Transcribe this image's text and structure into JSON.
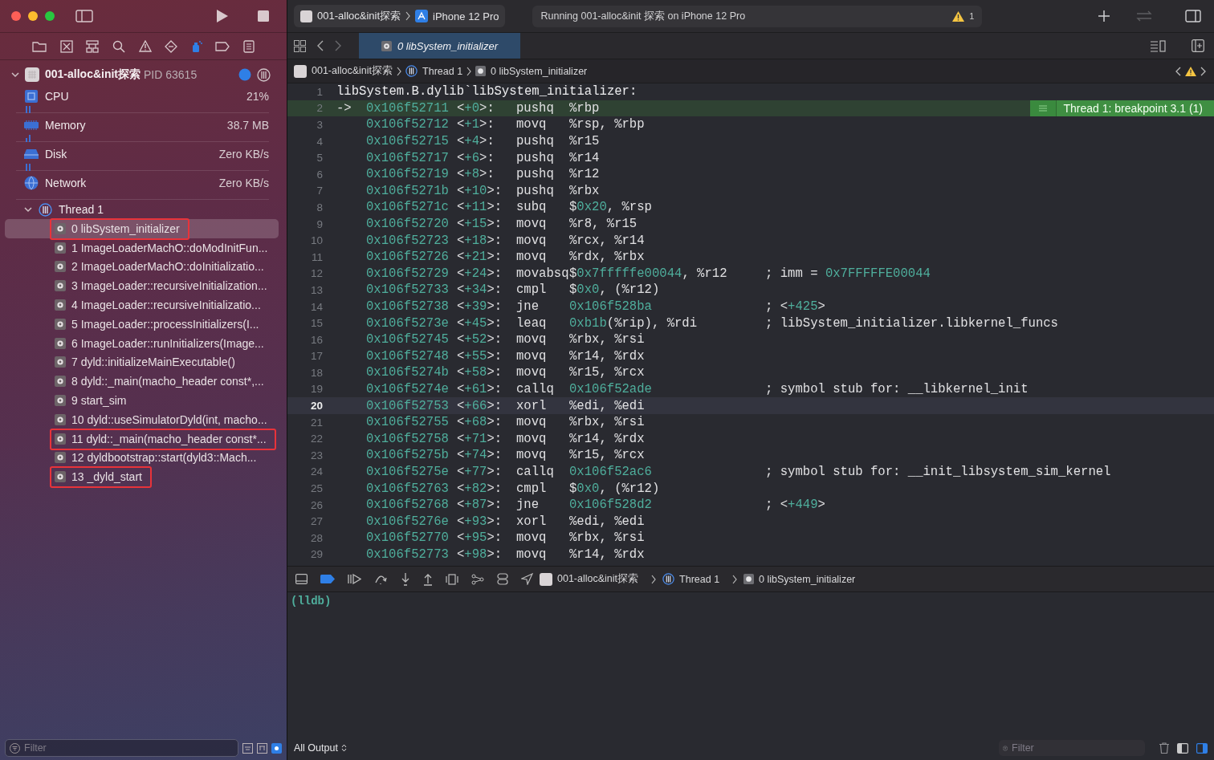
{
  "toolbar": {
    "scheme": "001-alloc&init探索",
    "device": "iPhone 12 Pro",
    "status": "Running 001-alloc&init 探索 on iPhone 12 Pro",
    "warning_count": "1"
  },
  "sidebar": {
    "process": {
      "name": "001-alloc&init探索",
      "pid": "PID 63615"
    },
    "gauges": [
      {
        "kind": "cpu",
        "name": "CPU",
        "value": "21%"
      },
      {
        "kind": "memory",
        "name": "Memory",
        "value": "38.7 MB"
      },
      {
        "kind": "disk",
        "name": "Disk",
        "value": "Zero KB/s"
      },
      {
        "kind": "network",
        "name": "Network",
        "value": "Zero KB/s"
      }
    ],
    "thread": {
      "name": "Thread 1",
      "expanded": true
    },
    "frames": [
      {
        "label": "0 libSystem_initializer",
        "selected": true,
        "annotated": true
      },
      {
        "label": "1 ImageLoaderMachO::doModInitFun...",
        "selected": false,
        "annotated": false
      },
      {
        "label": "2 ImageLoaderMachO::doInitializatio...",
        "selected": false,
        "annotated": false
      },
      {
        "label": "3 ImageLoader::recursiveInitialization...",
        "selected": false,
        "annotated": false
      },
      {
        "label": "4 ImageLoader::recursiveInitializatio...",
        "selected": false,
        "annotated": false
      },
      {
        "label": "5 ImageLoader::processInitializers(I...",
        "selected": false,
        "annotated": false
      },
      {
        "label": "6 ImageLoader::runInitializers(Image...",
        "selected": false,
        "annotated": false
      },
      {
        "label": "7 dyld::initializeMainExecutable()",
        "selected": false,
        "annotated": false
      },
      {
        "label": "8 dyld::_main(macho_header const*,...",
        "selected": false,
        "annotated": false
      },
      {
        "label": "9 start_sim",
        "selected": false,
        "annotated": false
      },
      {
        "label": "10 dyld::useSimulatorDyld(int, macho...",
        "selected": false,
        "annotated": false
      },
      {
        "label": "11 dyld::_main(macho_header const*...",
        "selected": false,
        "annotated": true
      },
      {
        "label": "12 dyldbootstrap::start(dyld3::Mach...",
        "selected": false,
        "annotated": false
      },
      {
        "label": "13 _dyld_start",
        "selected": false,
        "annotated": true
      }
    ],
    "filter": {
      "placeholder": "Filter"
    }
  },
  "tab": {
    "label": "0 libSystem_initializer",
    "selected": true
  },
  "breadcrumb": [
    "001-alloc&init探索",
    "Thread 1",
    "0 libSystem_initializer"
  ],
  "code": {
    "lines": [
      {
        "n": "1",
        "kind": "header",
        "text": "libSystem.B.dylib`libSystem_initializer:"
      },
      {
        "n": "2",
        "kind": "pc",
        "arrow": "->",
        "addr": "0x106f52711",
        "off": [
          "<",
          {
            "h": "+0"
          },
          ">:"
        ],
        "op": "pushq",
        "args": [
          "%rbp"
        ],
        "annotation": "Thread 1: breakpoint 3.1 (1)"
      },
      {
        "n": "3",
        "kind": "normal",
        "addr": "0x106f52712",
        "off": [
          "<",
          {
            "h": "+1"
          },
          ">:"
        ],
        "op": "movq",
        "args": [
          "%rsp, %rbp"
        ]
      },
      {
        "n": "4",
        "kind": "normal",
        "addr": "0x106f52715",
        "off": [
          "<",
          {
            "h": "+4"
          },
          ">:"
        ],
        "op": "pushq",
        "args": [
          "%r15"
        ]
      },
      {
        "n": "5",
        "kind": "normal",
        "addr": "0x106f52717",
        "off": [
          "<",
          {
            "h": "+6"
          },
          ">:"
        ],
        "op": "pushq",
        "args": [
          "%r14"
        ]
      },
      {
        "n": "6",
        "kind": "normal",
        "addr": "0x106f52719",
        "off": [
          "<",
          {
            "h": "+8"
          },
          ">:"
        ],
        "op": "pushq",
        "args": [
          "%r12"
        ]
      },
      {
        "n": "7",
        "kind": "normal",
        "addr": "0x106f5271b",
        "off": [
          "<",
          {
            "h": "+10"
          },
          ">:"
        ],
        "op": "pushq",
        "args": [
          "%rbx"
        ]
      },
      {
        "n": "8",
        "kind": "normal",
        "addr": "0x106f5271c",
        "off": [
          "<",
          {
            "h": "+11"
          },
          ">:"
        ],
        "op": "subq",
        "args": [
          "$",
          {
            "h": "0x20"
          },
          ", %rsp"
        ]
      },
      {
        "n": "9",
        "kind": "normal",
        "addr": "0x106f52720",
        "off": [
          "<",
          {
            "h": "+15"
          },
          ">:"
        ],
        "op": "movq",
        "args": [
          "%r8, %r15"
        ]
      },
      {
        "n": "10",
        "kind": "normal",
        "addr": "0x106f52723",
        "off": [
          "<",
          {
            "h": "+18"
          },
          ">:"
        ],
        "op": "movq",
        "args": [
          "%rcx, %r14"
        ]
      },
      {
        "n": "11",
        "kind": "normal",
        "addr": "0x106f52726",
        "off": [
          "<",
          {
            "h": "+21"
          },
          ">:"
        ],
        "op": "movq",
        "args": [
          "%rdx, %rbx"
        ]
      },
      {
        "n": "12",
        "kind": "normal",
        "addr": "0x106f52729",
        "off": [
          "<",
          {
            "h": "+24"
          },
          ">:"
        ],
        "op": "movabsq",
        "args": [
          "$",
          {
            "h": "0x7fffffe00044"
          },
          ", %r12"
        ],
        "comment": [
          "; imm = ",
          {
            "h": "0x7FFFFFE00044"
          }
        ]
      },
      {
        "n": "13",
        "kind": "normal",
        "addr": "0x106f52733",
        "off": [
          "<",
          {
            "h": "+34"
          },
          ">:"
        ],
        "op": "cmpl",
        "args": [
          "$",
          {
            "h": "0x0"
          },
          ", (%r12)"
        ]
      },
      {
        "n": "14",
        "kind": "normal",
        "addr": "0x106f52738",
        "off": [
          "<",
          {
            "h": "+39"
          },
          ">:"
        ],
        "op": "jne",
        "args": [
          {
            "h": "0x106f528ba"
          }
        ],
        "comment": [
          "; <",
          {
            "h": "+425"
          },
          ">"
        ]
      },
      {
        "n": "15",
        "kind": "normal",
        "addr": "0x106f5273e",
        "off": [
          "<",
          {
            "h": "+45"
          },
          ">:"
        ],
        "op": "leaq",
        "args": [
          {
            "h": "0xb1b"
          },
          "(%rip), %rdi"
        ],
        "comment": [
          "; libSystem_initializer.libkernel_funcs"
        ]
      },
      {
        "n": "16",
        "kind": "normal",
        "addr": "0x106f52745",
        "off": [
          "<",
          {
            "h": "+52"
          },
          ">:"
        ],
        "op": "movq",
        "args": [
          "%rbx, %rsi"
        ]
      },
      {
        "n": "17",
        "kind": "normal",
        "addr": "0x106f52748",
        "off": [
          "<",
          {
            "h": "+55"
          },
          ">:"
        ],
        "op": "movq",
        "args": [
          "%r14, %rdx"
        ]
      },
      {
        "n": "18",
        "kind": "normal",
        "addr": "0x106f5274b",
        "off": [
          "<",
          {
            "h": "+58"
          },
          ">:"
        ],
        "op": "movq",
        "args": [
          "%r15, %rcx"
        ]
      },
      {
        "n": "19",
        "kind": "normal",
        "addr": "0x106f5274e",
        "off": [
          "<",
          {
            "h": "+61"
          },
          ">:"
        ],
        "op": "callq",
        "args": [
          {
            "h": "0x106f52ade"
          }
        ],
        "comment": [
          "; symbol stub for: __libkernel_init"
        ]
      },
      {
        "n": "20",
        "kind": "cursor",
        "addr": "0x106f52753",
        "off": [
          "<",
          {
            "h": "+66"
          },
          ">:"
        ],
        "op": "xorl",
        "args": [
          "%edi, %edi"
        ]
      },
      {
        "n": "21",
        "kind": "normal",
        "addr": "0x106f52755",
        "off": [
          "<",
          {
            "h": "+68"
          },
          ">:"
        ],
        "op": "movq",
        "args": [
          "%rbx, %rsi"
        ]
      },
      {
        "n": "22",
        "kind": "normal",
        "addr": "0x106f52758",
        "off": [
          "<",
          {
            "h": "+71"
          },
          ">:"
        ],
        "op": "movq",
        "args": [
          "%r14, %rdx"
        ]
      },
      {
        "n": "23",
        "kind": "normal",
        "addr": "0x106f5275b",
        "off": [
          "<",
          {
            "h": "+74"
          },
          ">:"
        ],
        "op": "movq",
        "args": [
          "%r15, %rcx"
        ]
      },
      {
        "n": "24",
        "kind": "normal",
        "addr": "0x106f5275e",
        "off": [
          "<",
          {
            "h": "+77"
          },
          ">:"
        ],
        "op": "callq",
        "args": [
          {
            "h": "0x106f52ac6"
          }
        ],
        "comment": [
          "; symbol stub for: __init_libsystem_sim_kernel"
        ]
      },
      {
        "n": "25",
        "kind": "normal",
        "addr": "0x106f52763",
        "off": [
          "<",
          {
            "h": "+82"
          },
          ">:"
        ],
        "op": "cmpl",
        "args": [
          "$",
          {
            "h": "0x0"
          },
          ", (%r12)"
        ]
      },
      {
        "n": "26",
        "kind": "normal",
        "addr": "0x106f52768",
        "off": [
          "<",
          {
            "h": "+87"
          },
          ">:"
        ],
        "op": "jne",
        "args": [
          {
            "h": "0x106f528d2"
          }
        ],
        "comment": [
          "; <",
          {
            "h": "+449"
          },
          ">"
        ]
      },
      {
        "n": "27",
        "kind": "normal",
        "addr": "0x106f5276e",
        "off": [
          "<",
          {
            "h": "+93"
          },
          ">:"
        ],
        "op": "xorl",
        "args": [
          "%edi, %edi"
        ]
      },
      {
        "n": "28",
        "kind": "normal",
        "addr": "0x106f52770",
        "off": [
          "<",
          {
            "h": "+95"
          },
          ">:"
        ],
        "op": "movq",
        "args": [
          "%rbx, %rsi"
        ]
      },
      {
        "n": "29",
        "kind": "normal",
        "addr": "0x106f52773",
        "off": [
          "<",
          {
            "h": "+98"
          },
          ">:"
        ],
        "op": "movq",
        "args": [
          "%r14, %rdx"
        ]
      }
    ]
  },
  "debug_bar": {
    "breadcrumb": [
      "001-alloc&init探索",
      "Thread 1",
      "0 libSystem_initializer"
    ]
  },
  "console": {
    "prompt": "(lldb)",
    "output_selector": "All Output",
    "filter": {
      "placeholder": "Filter"
    }
  }
}
